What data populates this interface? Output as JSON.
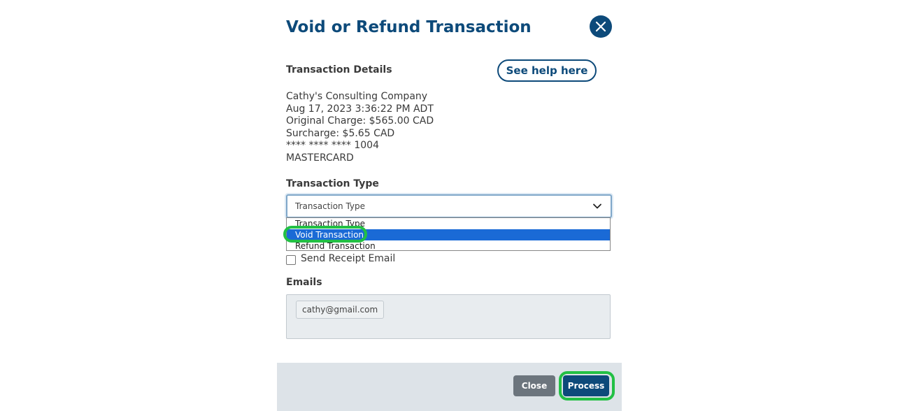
{
  "modal": {
    "title": "Void or Refund Transaction"
  },
  "details": {
    "heading": "Transaction Details",
    "help_label": "See help here",
    "lines": [
      "Cathy's Consulting Company",
      "Aug 17, 2023 3:36:22 PM ADT",
      "Original Charge: $565.00 CAD",
      "Surcharge: $5.65 CAD",
      "**** **** **** 1004",
      "MASTERCARD"
    ]
  },
  "transaction_type": {
    "label": "Transaction Type",
    "selected_value": "Transaction Type",
    "options": [
      "Transaction Type",
      "Void Transaction",
      "Refund Transaction"
    ],
    "highlighted_option": "Void Transaction"
  },
  "receipt": {
    "checkbox_label": "Send Receipt Email",
    "checked": false
  },
  "emails": {
    "label": "Emails",
    "chips": [
      "cathy@gmail.com"
    ]
  },
  "footer": {
    "close_label": "Close",
    "process_label": "Process"
  },
  "colors": {
    "brand": "#0d4a7a",
    "highlight_ring": "#22c044",
    "selected_option": "#1a6ad6",
    "close_button": "#6c757d",
    "footer_bg": "#dde3e8"
  }
}
